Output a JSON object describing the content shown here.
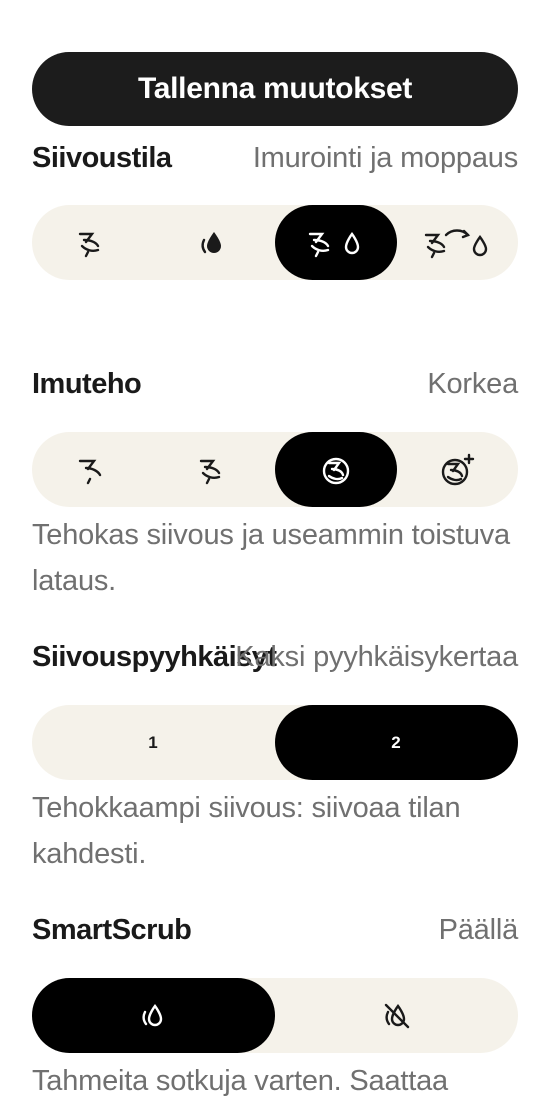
{
  "save_button": {
    "label": "Tallenna muutokset"
  },
  "cleaning_mode": {
    "title": "Siivoustila",
    "value": "Imurointi ja moppaus",
    "options": [
      {
        "icon": "vacuum-icon",
        "selected": false
      },
      {
        "icon": "mop-drop-icon",
        "selected": false
      },
      {
        "icon": "vacuum-and-mop-icon",
        "selected": true
      },
      {
        "icon": "vacuum-then-mop-icon",
        "selected": false
      }
    ]
  },
  "suction_power": {
    "title": "Imuteho",
    "value": "Korkea",
    "description": "Tehokas siivous ja useammin toistuva lataus.",
    "options": [
      {
        "icon": "fan-low-icon",
        "selected": false
      },
      {
        "icon": "fan-medium-icon",
        "selected": false
      },
      {
        "icon": "fan-high-icon",
        "selected": true
      },
      {
        "icon": "fan-max-icon",
        "selected": false
      }
    ]
  },
  "cleaning_passes": {
    "title": "Siivouspyyhkäisyt",
    "value": "Kaksi pyyhkäisykertaa",
    "description": "Tehokkaampi siivous: siivoaa tilan kahdesti.",
    "options": [
      {
        "label": "1",
        "selected": false
      },
      {
        "label": "2",
        "selected": true
      }
    ]
  },
  "smartscrub": {
    "title": "SmartScrub",
    "value": "Päällä",
    "description": "Tahmeita sotkuja varten. Saattaa",
    "options": [
      {
        "icon": "smartscrub-on-icon",
        "selected": true
      },
      {
        "icon": "smartscrub-off-icon",
        "selected": false
      }
    ]
  },
  "colors": {
    "button_bg": "#1c1c1c",
    "segment_bg": "#f5f2ea",
    "selected_bg": "#000000",
    "secondary_text": "#707070"
  }
}
